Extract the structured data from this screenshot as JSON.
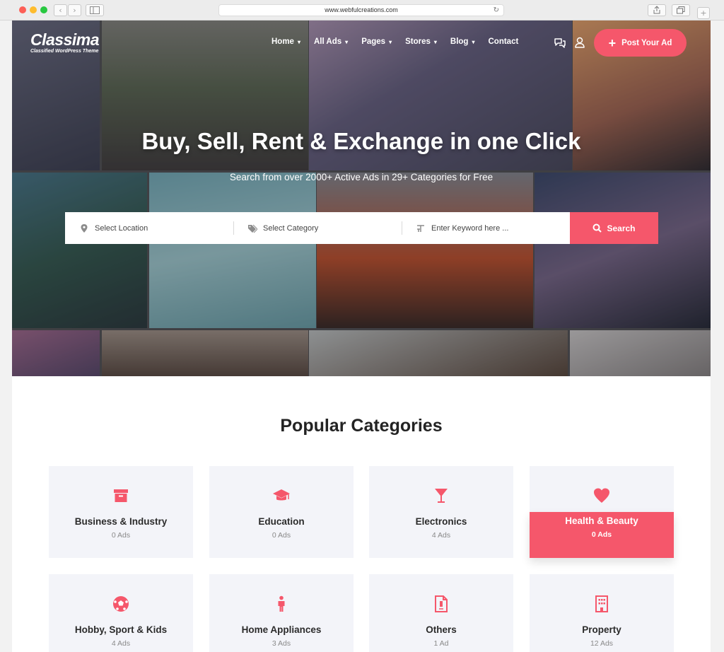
{
  "browser": {
    "url": "www.webfulcreations.com",
    "back": "‹",
    "forward": "›",
    "reload": "↻"
  },
  "brand": {
    "name": "Classima",
    "tagline": "Classified WordPress Theme",
    "accent": "#f5576b"
  },
  "nav": {
    "items": [
      {
        "label": "Home",
        "dropdown": true
      },
      {
        "label": "All Ads",
        "dropdown": true
      },
      {
        "label": "Pages",
        "dropdown": true
      },
      {
        "label": "Stores",
        "dropdown": true
      },
      {
        "label": "Blog",
        "dropdown": true
      },
      {
        "label": "Contact",
        "dropdown": false
      }
    ],
    "chev": "▾",
    "post_button": "Post Your Ad",
    "post_plus": "+"
  },
  "hero": {
    "title": "Buy, Sell, Rent & Exchange in one Click",
    "subtitle": "Search from over 2000+ Active Ads in 29+ Categories for Free"
  },
  "search": {
    "location": "Select Location",
    "category": "Select Category",
    "keyword_placeholder": "Enter Keyword here ...",
    "button": "Search"
  },
  "categories": {
    "title": "Popular Categories",
    "items": [
      {
        "name": "Business & Industry",
        "count": "0 Ads",
        "icon": "archive-box-icon"
      },
      {
        "name": "Education",
        "count": "0 Ads",
        "icon": "graduation-cap-icon"
      },
      {
        "name": "Electronics",
        "count": "4 Ads",
        "icon": "cocktail-glass-icon"
      },
      {
        "name": "Health & Beauty",
        "count": "0 Ads",
        "icon": "heart-icon",
        "active": true
      },
      {
        "name": "Hobby, Sport & Kids",
        "count": "4 Ads",
        "icon": "soccer-ball-icon"
      },
      {
        "name": "Home Appliances",
        "count": "3 Ads",
        "icon": "person-icon"
      },
      {
        "name": "Others",
        "count": "1 Ad",
        "icon": "document-icon"
      },
      {
        "name": "Property",
        "count": "12 Ads",
        "icon": "building-icon"
      }
    ]
  }
}
